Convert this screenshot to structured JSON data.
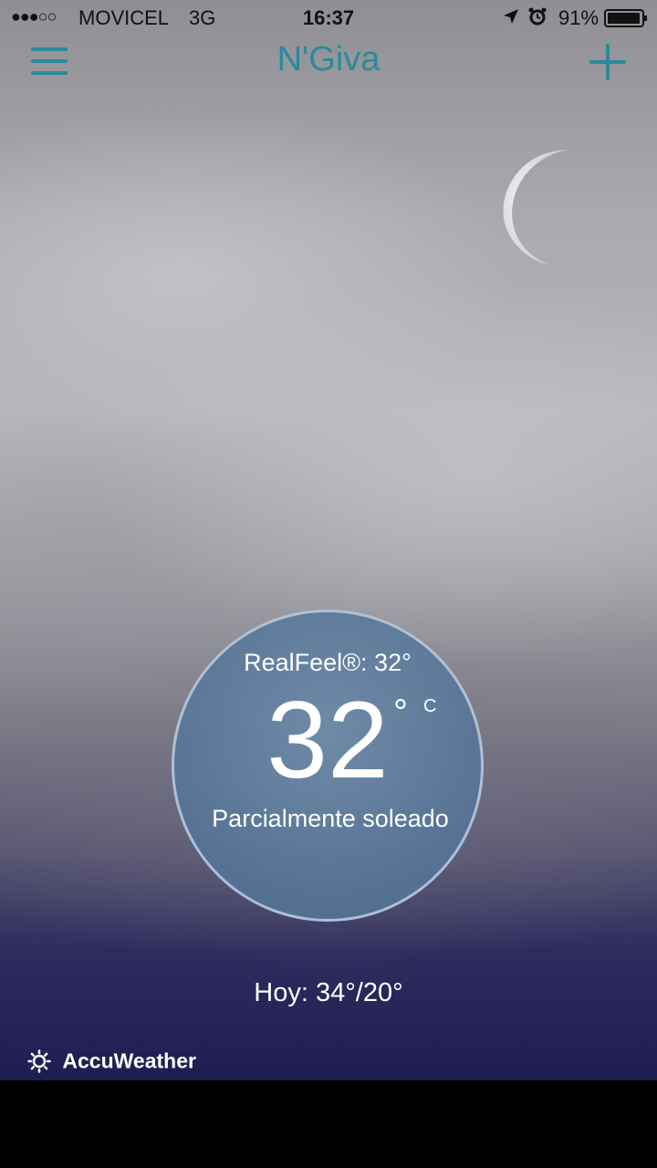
{
  "status_bar": {
    "signal": "●●●○○",
    "carrier": "MOVICEL",
    "network": "3G",
    "time": "16:37",
    "battery": "91%"
  },
  "nav": {
    "title": "N'Giva",
    "menu_icon": "hamburger-menu-icon",
    "add_icon": "plus-icon"
  },
  "weather": {
    "realfeel": "RealFeel®: 32°",
    "temperature": "32",
    "degree_symbol": "°",
    "unit": "C",
    "condition": "Parcialmente soleado",
    "today": "Hoy: 34°/20°"
  },
  "brand": {
    "name": "AccuWeather"
  },
  "colors": {
    "accent": "#2a8a9c",
    "circle": "#6b8db0",
    "sky_bottom": "#1e1d52"
  }
}
